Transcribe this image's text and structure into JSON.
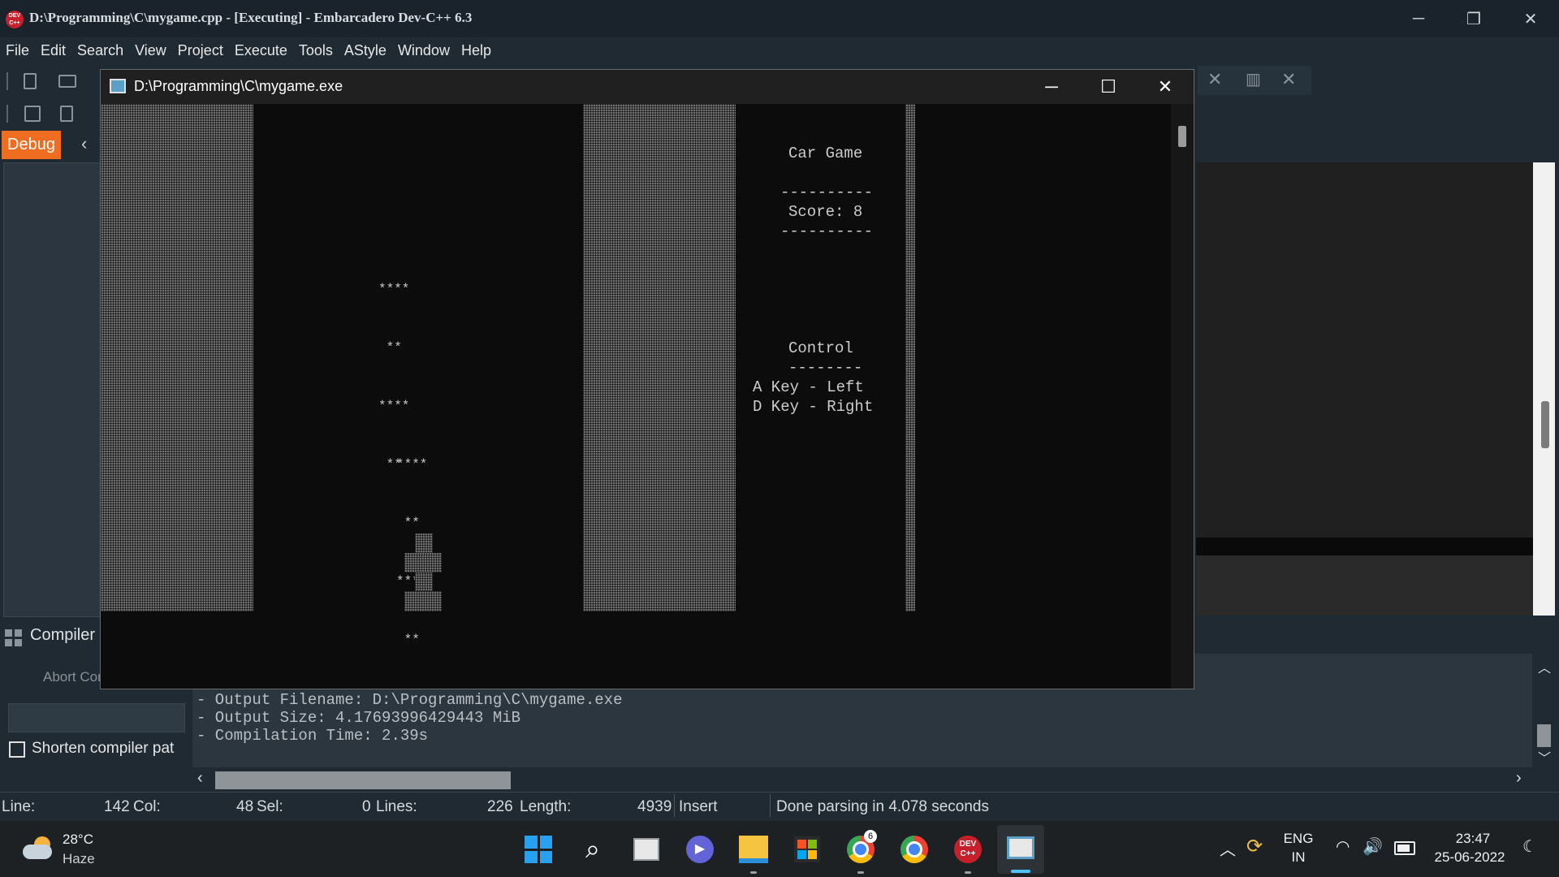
{
  "ide": {
    "title": "D:\\Programming\\C\\mygame.cpp - [Executing] - Embarcadero Dev-C++ 6.3",
    "logo_text": "DEV C++",
    "menu": [
      "File",
      "Edit",
      "Search",
      "View",
      "Project",
      "Execute",
      "Tools",
      "AStyle",
      "Window",
      "Help"
    ],
    "minimize": "─",
    "restore": "❐",
    "close": "✕"
  },
  "debug": {
    "tab_label": "Debug",
    "collapse_arrow": "‹"
  },
  "console": {
    "title": "D:\\Programming\\C\\mygame.exe",
    "minimize": "─",
    "maximize": "☐",
    "close": "✕",
    "game_title": "Car Game",
    "divider_long": "----------",
    "score_text": "Score: 8",
    "control_title": "Control",
    "divider_short": "--------",
    "control_left": "A Key - Left",
    "control_right": "D Key - Right",
    "enemy_lines": [
      "****",
      " ** ",
      "****",
      " ** "
    ]
  },
  "compiler": {
    "tab_label": "Compiler",
    "abort_label": "Abort Cor",
    "shorten_label": "Shorten compiler pat",
    "log": [
      "- Output Filename: D:\\Programming\\C\\mygame.exe",
      "- Output Size: 4.17693996429443 MiB",
      "- Compilation Time: 2.39s"
    ]
  },
  "status": {
    "line_label": "Line:",
    "line_value": "142",
    "col_label": "Col:",
    "col_value": "48",
    "sel_label": "Sel:",
    "sel_value": "0",
    "lines_label": "Lines:",
    "lines_value": "226",
    "length_label": "Length:",
    "length_value": "4939",
    "mode": "Insert",
    "message": "Done parsing in 4.078 seconds"
  },
  "taskbar": {
    "weather_temp": "28°C",
    "weather_desc": "Haze",
    "lang_top": "ENG",
    "lang_bottom": "IN",
    "time": "23:47",
    "date": "25-06-2022",
    "chrome_badge": "6"
  }
}
